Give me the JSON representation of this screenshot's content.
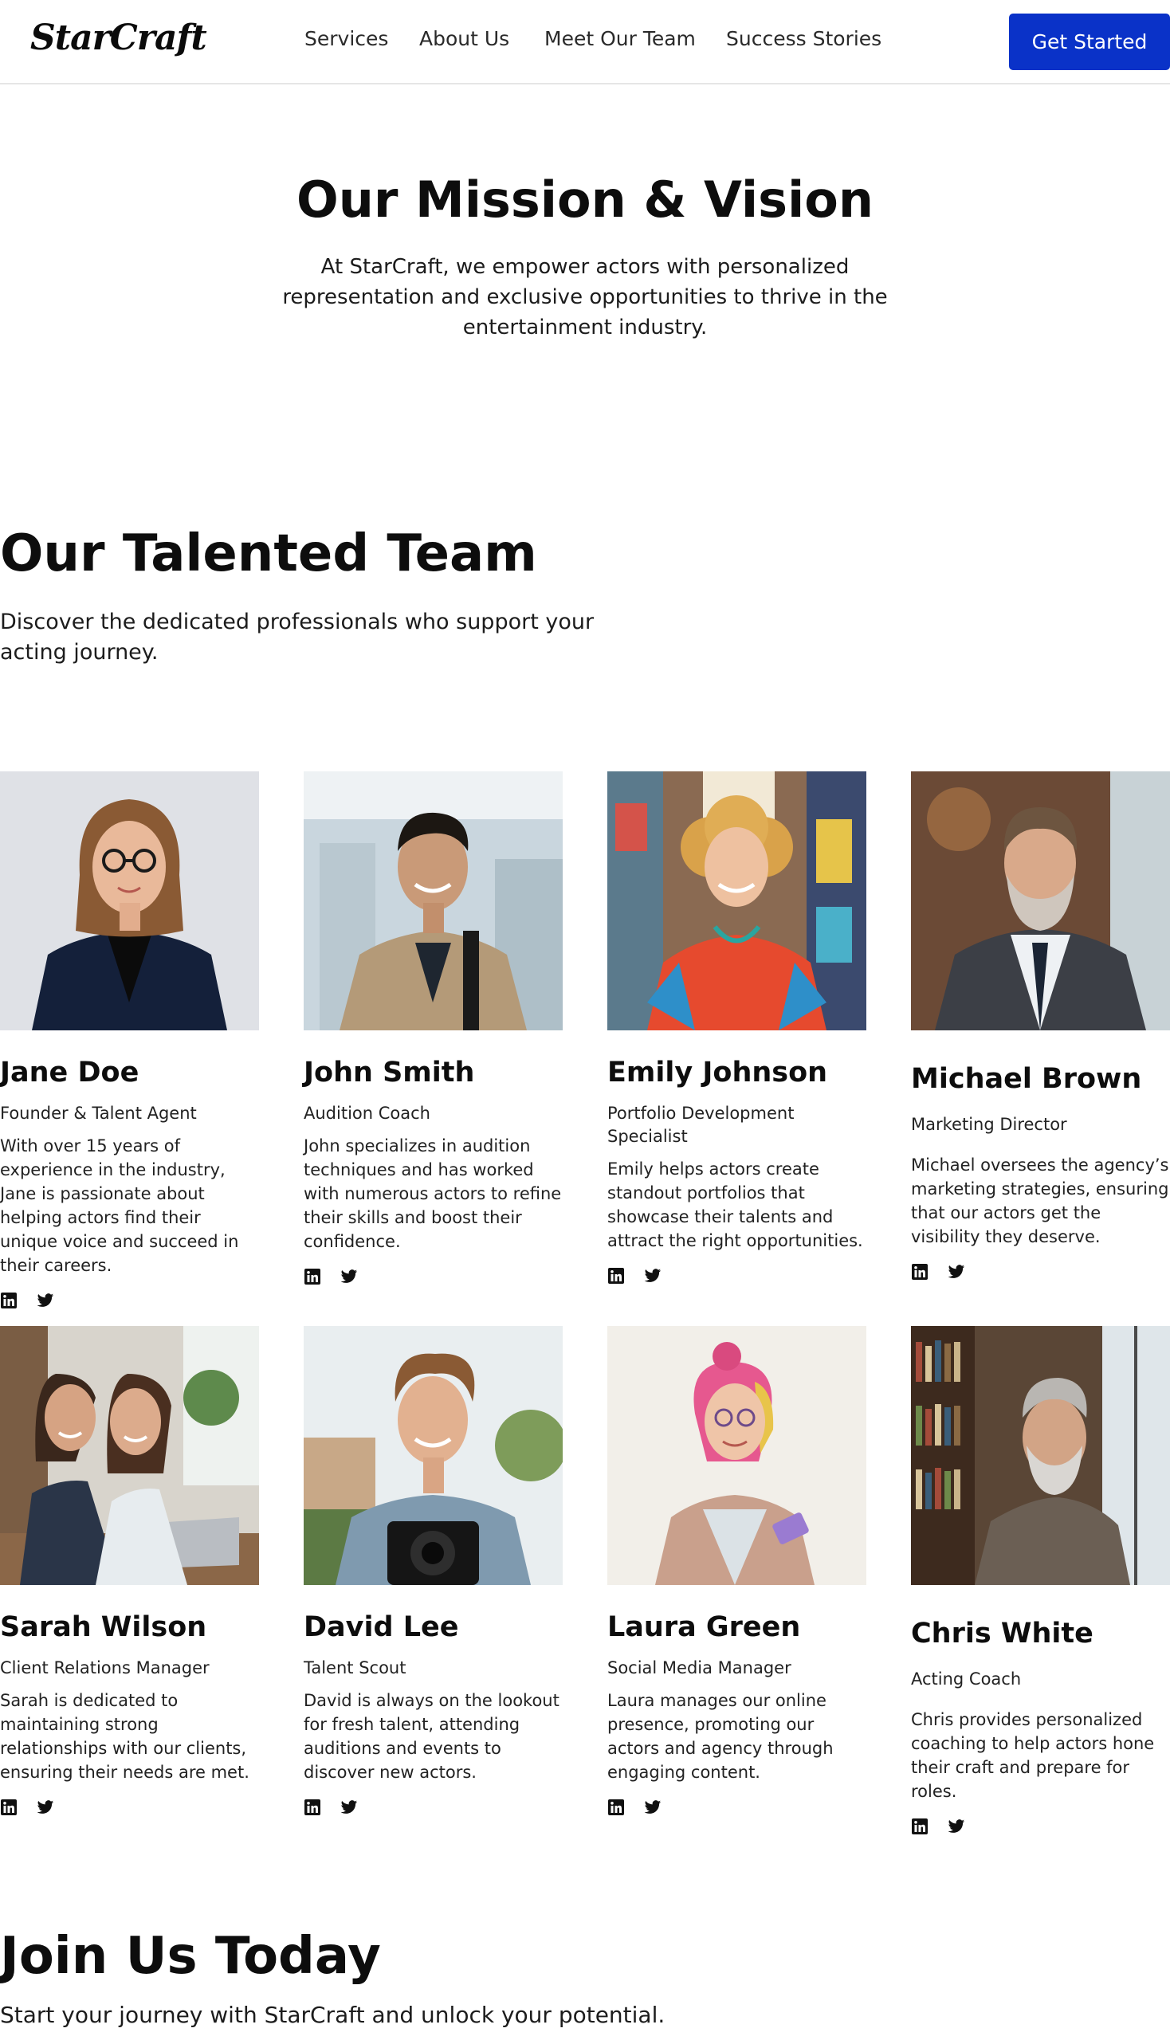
{
  "nav": {
    "logo": "StarCraft",
    "links": [
      "Services",
      "About Us",
      "Meet Our Team",
      "Success Stories"
    ],
    "cta": "Get Started",
    "accent": "#0a32c8"
  },
  "mission": {
    "title": "Our Mission & Vision",
    "text": "At StarCraft, we empower actors with personalized representation and exclusive opportunities to thrive in the entertainment industry."
  },
  "team": {
    "title": "Our Talented Team",
    "subtitle": "Discover the dedicated professionals who support your acting journey.",
    "members": [
      {
        "name": "Jane Doe",
        "role": "Founder & Talent Agent",
        "bio": "With over 15 years of experience in the industry, Jane is passionate about helping actors find their unique voice and succeed in their careers.",
        "photo": "portrait-woman-glasses-blazer"
      },
      {
        "name": "John Smith",
        "role": "Audition Coach",
        "bio": "John specializes in audition techniques and has worked with numerous actors to refine their skills and boost their confidence.",
        "photo": "portrait-man-backpack"
      },
      {
        "name": "Emily Johnson",
        "role": "Portfolio Development Specialist",
        "bio": "Emily helps actors create standout portfolios that showcase their talents and attract the right opportunities.",
        "photo": "portrait-woman-curly-hair-colorful"
      },
      {
        "name": "Michael Brown",
        "role": "Marketing Director",
        "bio": "Michael oversees the agency’s marketing strategies, ensuring that our actors get the visibility they deserve.",
        "photo": "portrait-man-beard-suit"
      },
      {
        "name": "Sarah Wilson",
        "role": "Client Relations Manager",
        "bio": "Sarah is dedicated to maintaining strong relationships with our clients, ensuring their needs are met.",
        "photo": "portrait-two-women-laptop"
      },
      {
        "name": "David Lee",
        "role": "Talent Scout",
        "bio": "David is always on the lookout for fresh talent, attending auditions and events to discover new actors.",
        "photo": "portrait-young-man-camera"
      },
      {
        "name": "Laura Green",
        "role": "Social Media Manager",
        "bio": "Laura manages our online presence, promoting our actors and agency through engaging content.",
        "photo": "portrait-woman-pink-hair-phone"
      },
      {
        "name": "Chris White",
        "role": "Acting Coach",
        "bio": "Chris provides personalized coaching to help actors hone their craft and prepare for roles.",
        "photo": "portrait-older-man-library"
      }
    ],
    "social_icons": [
      "linkedin-icon",
      "twitter-icon"
    ]
  },
  "join": {
    "title": "Join Us Today",
    "text": "Start your journey with StarCraft and unlock your potential."
  }
}
